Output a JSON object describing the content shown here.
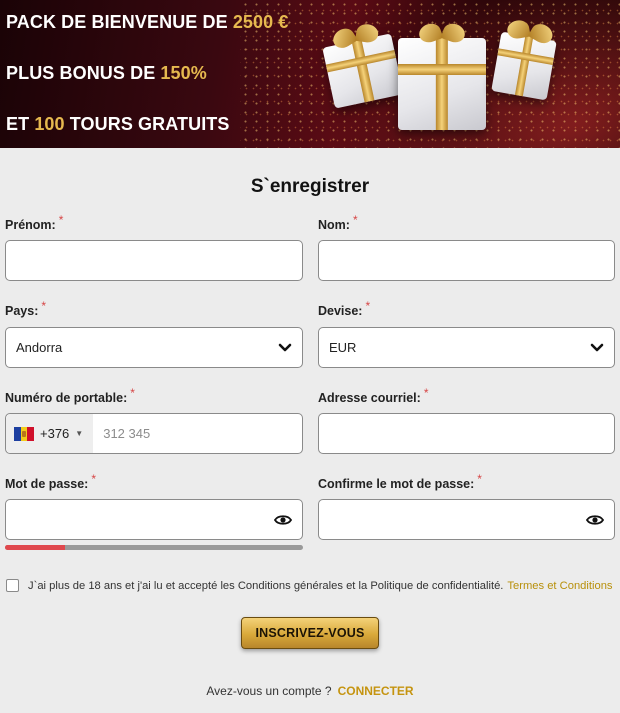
{
  "banner": {
    "line1_prefix": "PACK DE BIENVENUE DE ",
    "line1_highlight": "2500 €",
    "line2_prefix": "PLUS BONUS DE ",
    "line2_highlight": "150%",
    "line3_prefix": "ET ",
    "line3_highlight": "100",
    "line3_suffix": " TOURS GRATUITS",
    "highlight_color": "#e6b94f"
  },
  "form": {
    "title": "S`enregistrer",
    "required_mark": "*",
    "first_name": {
      "label": "Prénom:",
      "value": ""
    },
    "last_name": {
      "label": "Nom:",
      "value": ""
    },
    "country": {
      "label": "Pays:",
      "value": "Andorra"
    },
    "currency": {
      "label": "Devise:",
      "value": "EUR"
    },
    "phone": {
      "label": "Numéro de portable:",
      "dial_code": "+376",
      "placeholder": "312 345",
      "flag": "andorra-flag"
    },
    "email": {
      "label": "Adresse courriel:",
      "value": ""
    },
    "password": {
      "label": "Mot de passe:",
      "value": "",
      "strength_fraction": 0.2
    },
    "confirm_password": {
      "label": "Confirme le mot de passe:",
      "value": ""
    },
    "consent": {
      "text": "J`ai plus de 18 ans et j'ai lu et accepté les Conditions générales et la Politique de confidentialité.",
      "link": "Termes et Conditions",
      "checked": false
    },
    "submit_label": "INSCRIVEZ-VOUS",
    "login_prompt": "Avez-vous un compte ?",
    "login_link": "CONNECTER"
  },
  "colors": {
    "accent_gold": "#c59410",
    "required_red": "#d64545",
    "strength_red": "#e0484d"
  }
}
